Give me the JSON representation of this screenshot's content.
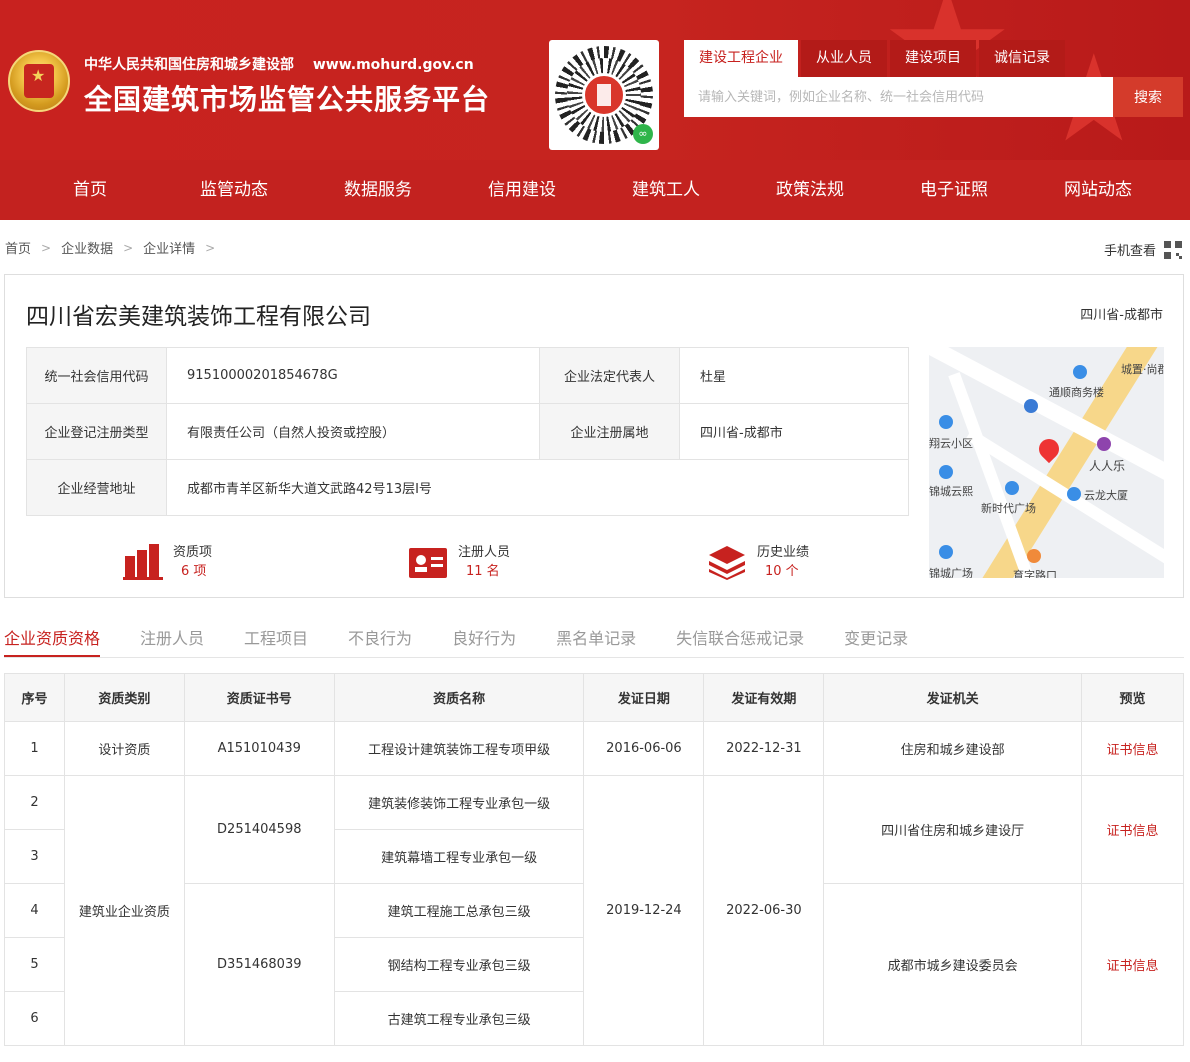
{
  "header": {
    "org_name": "中华人民共和国住房和城乡建设部",
    "org_url": "www.mohurd.gov.cn",
    "platform_title": "全国建筑市场监管公共服务平台"
  },
  "search": {
    "tabs": [
      "建设工程企业",
      "从业人员",
      "建设项目",
      "诚信记录"
    ],
    "placeholder": "请输入关键词，例如企业名称、统一社会信用代码",
    "button_label": "搜索"
  },
  "nav": {
    "items": [
      "首页",
      "监管动态",
      "数据服务",
      "信用建设",
      "建筑工人",
      "政策法规",
      "电子证照",
      "网站动态"
    ]
  },
  "breadcrumb": {
    "items": [
      "首页",
      "企业数据",
      "企业详情"
    ],
    "mobile_view_label": "手机查看"
  },
  "company": {
    "name": "四川省宏美建筑装饰工程有限公司",
    "region": "四川省-成都市",
    "info": {
      "credit_code_label": "统一社会信用代码",
      "credit_code": "91510000201854678G",
      "legal_rep_label": "企业法定代表人",
      "legal_rep": "杜星",
      "reg_type_label": "企业登记注册类型",
      "reg_type": "有限责任公司（自然人投资或控股）",
      "reg_place_label": "企业注册属地",
      "reg_place": "四川省-成都市",
      "address_label": "企业经营地址",
      "address": "成都市青羊区新华大道文武路42号13层I号"
    },
    "stats": [
      {
        "label": "资质项",
        "count": "6 项"
      },
      {
        "label": "注册人员",
        "count": "11 名"
      },
      {
        "label": "历史业绩",
        "count": "10 个"
      }
    ],
    "map_labels": [
      "城置·尚郡",
      "通顺商务楼",
      "翔云小区",
      "人人乐",
      "锦城云熙",
      "新时代广场",
      "云龙大厦",
      "锦城广场",
      "育字路口"
    ]
  },
  "tabs": {
    "items": [
      "企业资质资格",
      "注册人员",
      "工程项目",
      "不良行为",
      "良好行为",
      "黑名单记录",
      "失信联合惩戒记录",
      "变更记录"
    ]
  },
  "qualifications": {
    "headers": [
      "序号",
      "资质类别",
      "资质证书号",
      "资质名称",
      "发证日期",
      "发证有效期",
      "发证机关",
      "预览"
    ],
    "rows": [
      {
        "no": "1",
        "category": "设计资质",
        "cert_no": "A151010439",
        "name": "工程设计建筑装饰工程专项甲级",
        "issue_date": "2016-06-06",
        "valid_until": "2022-12-31",
        "authority": "住房和城乡建设部",
        "preview": "证书信息"
      },
      {
        "no": "2",
        "category": "建筑业企业资质",
        "cert_no": "D251404598",
        "name": "建筑装修装饰工程专业承包一级",
        "issue_date": "2019-12-24",
        "valid_until": "2022-06-30",
        "authority": "四川省住房和城乡建设厅",
        "preview": "证书信息"
      },
      {
        "no": "3",
        "name": "建筑幕墙工程专业承包一级"
      },
      {
        "no": "4",
        "cert_no": "D351468039",
        "name": "建筑工程施工总承包三级",
        "authority": "成都市城乡建设委员会",
        "preview": "证书信息"
      },
      {
        "no": "5",
        "name": "钢结构工程专业承包三级"
      },
      {
        "no": "6",
        "name": "古建筑工程专业承包三级"
      }
    ]
  }
}
